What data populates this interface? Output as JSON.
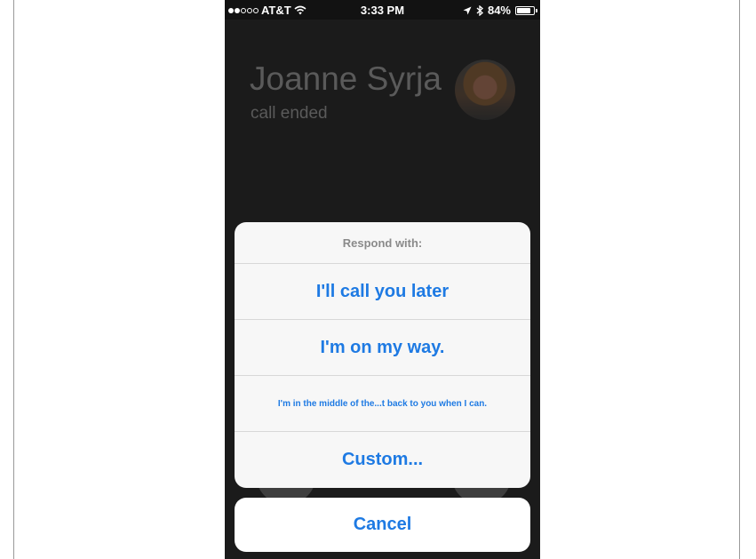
{
  "status_bar": {
    "signal_dots_filled": 2,
    "signal_dots_total": 5,
    "carrier": "AT&T",
    "time": "3:33 PM",
    "battery": "84%",
    "battery_level": 0.84
  },
  "call": {
    "caller_name": "Joanne Syrja",
    "status": "call ended"
  },
  "action_sheet": {
    "title": "Respond with:",
    "options": [
      "I'll call you later",
      "I'm on my way.",
      "I'm in the middle of the...t back to you when I can.",
      "Custom..."
    ],
    "cancel_label": "Cancel"
  },
  "colors": {
    "accent": "#1e7ae3",
    "background": "#1b1b1b",
    "sheet": "#f7f7f7"
  }
}
